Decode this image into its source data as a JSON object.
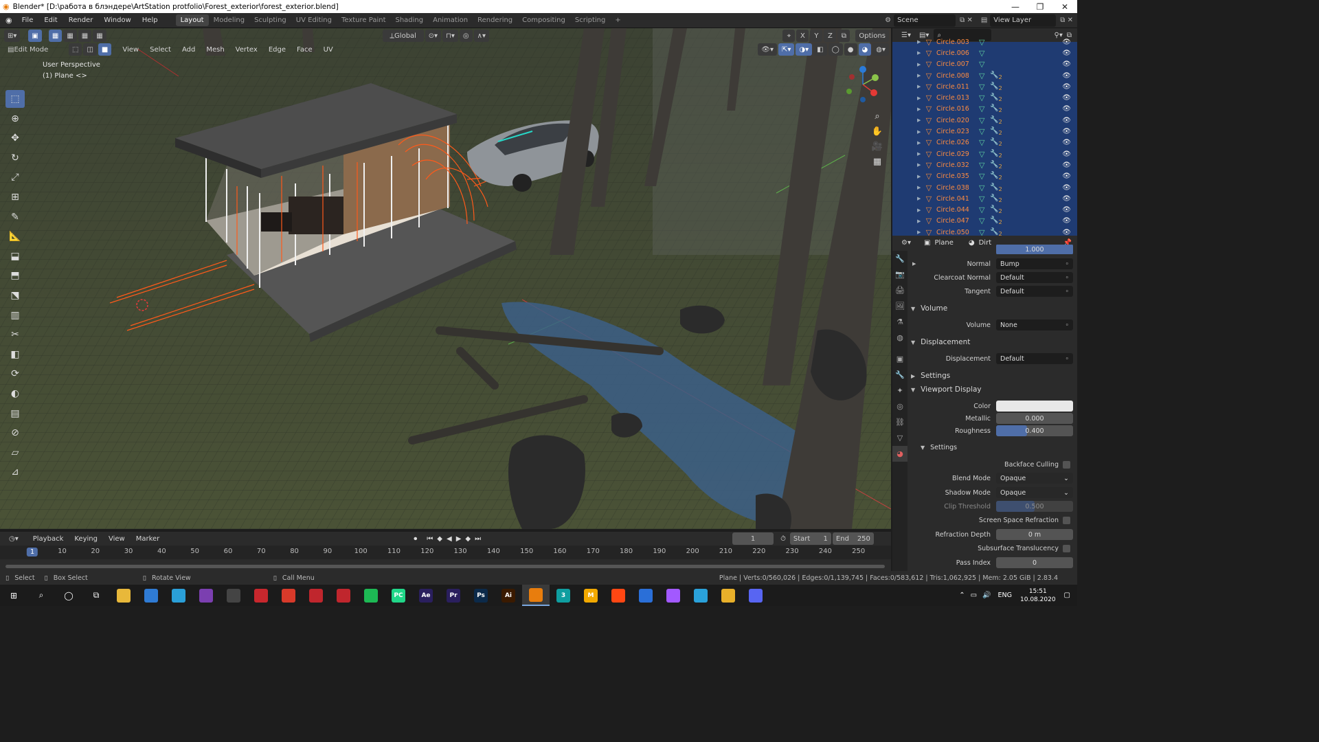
{
  "window": {
    "title": "Blender* [D:\\работа в блэндере\\ArtStation protfolio\\Forest_exterior\\forest_exterior.blend]",
    "minimize": "—",
    "maximize": "❐",
    "close": "✕"
  },
  "menu": [
    "File",
    "Edit",
    "Render",
    "Window",
    "Help"
  ],
  "workspaces": [
    "Layout",
    "Modeling",
    "Sculpting",
    "UV Editing",
    "Texture Paint",
    "Shading",
    "Animation",
    "Rendering",
    "Compositing",
    "Scripting"
  ],
  "workspace_add": "+",
  "scene_name": "Scene",
  "view_layer": "View Layer",
  "viewport_header": {
    "transform_orientation": "Global",
    "axis_x": "X",
    "axis_y": "Y",
    "axis_z": "Z",
    "options": "Options",
    "mode": "Edit Mode",
    "menus": [
      "View",
      "Select",
      "Add",
      "Mesh",
      "Vertex",
      "Edge",
      "Face",
      "UV"
    ]
  },
  "viewport_info": {
    "perspective": "User Perspective",
    "object": "(1) Plane <>"
  },
  "tools": [
    "select-box-icon",
    "cursor-icon",
    "move-icon",
    "rotate-icon",
    "scale-icon",
    "transform-icon",
    "annotate-icon",
    "measure-icon",
    "extrude-icon",
    "inset-icon",
    "bevel-icon",
    "loop-cut-icon",
    "knife-icon",
    "poly-build-icon",
    "spin-icon",
    "smooth-icon",
    "edge-slide-icon",
    "shrink-icon",
    "shear-icon",
    "rip-icon"
  ],
  "outliner": {
    "search_placeholder": "",
    "items": [
      "Circle.003",
      "Circle.006",
      "Circle.007",
      "Circle.008",
      "Circle.011",
      "Circle.013",
      "Circle.016",
      "Circle.020",
      "Circle.023",
      "Circle.026",
      "Circle.029",
      "Circle.032",
      "Circle.035",
      "Circle.038",
      "Circle.041",
      "Circle.044",
      "Circle.047",
      "Circle.050"
    ],
    "modifier_badge": "2"
  },
  "properties": {
    "object": "Plane",
    "material": "Dirt",
    "alpha_value": "1.000",
    "rows": {
      "normal": {
        "label": "Normal",
        "value": "Bump"
      },
      "clearcoat_normal": {
        "label": "Clearcoat Normal",
        "value": "Default"
      },
      "tangent": {
        "label": "Tangent",
        "value": "Default"
      },
      "volume_section": "Volume",
      "volume": {
        "label": "Volume",
        "value": "None"
      },
      "displacement_section": "Displacement",
      "displacement": {
        "label": "Displacement",
        "value": "Default"
      },
      "settings_section": "Settings",
      "viewport_display_section": "Viewport Display",
      "color": {
        "label": "Color"
      },
      "metallic": {
        "label": "Metallic",
        "value": "0.000",
        "fraction": 0.0
      },
      "roughness": {
        "label": "Roughness",
        "value": "0.400",
        "fraction": 0.4
      },
      "sub_settings_section": "Settings",
      "backface_culling": {
        "label": "Backface Culling"
      },
      "blend_mode": {
        "label": "Blend Mode",
        "value": "Opaque"
      },
      "shadow_mode": {
        "label": "Shadow Mode",
        "value": "Opaque"
      },
      "clip_threshold": {
        "label": "Clip Threshold",
        "value": "0.500",
        "fraction": 0.5
      },
      "ssr": {
        "label": "Screen Space Refraction"
      },
      "refraction_depth": {
        "label": "Refraction Depth",
        "value": "0 m"
      },
      "sss": {
        "label": "Subsurface Translucency"
      },
      "pass_index": {
        "label": "Pass Index",
        "value": "0"
      }
    }
  },
  "timeline": {
    "menus": [
      "Playback",
      "Keying",
      "View",
      "Marker"
    ],
    "current_frame": "1",
    "start_label": "Start",
    "start": "1",
    "end_label": "End",
    "end": "250",
    "ticks": [
      "1",
      "10",
      "20",
      "30",
      "40",
      "50",
      "60",
      "70",
      "80",
      "90",
      "100",
      "110",
      "120",
      "130",
      "140",
      "150",
      "160",
      "170",
      "180",
      "190",
      "200",
      "210",
      "220",
      "230",
      "240",
      "250"
    ]
  },
  "statusbar": {
    "select": "Select",
    "box_select": "Box Select",
    "rotate_view": "Rotate View",
    "call_menu": "Call Menu",
    "stats": "Plane | Verts:0/560,026 | Edges:0/1,139,745 | Faces:0/583,612 | Tris:1,062,925 | Mem: 2.05 GiB | 2.83.4"
  },
  "taskbar": {
    "apps": [
      {
        "name": "file-explorer",
        "label": "",
        "color": "#e8b83a"
      },
      {
        "name": "mail",
        "label": "",
        "color": "#2f7bd4"
      },
      {
        "name": "edge",
        "label": "",
        "color": "#2a9fd8"
      },
      {
        "name": "tor",
        "label": "",
        "color": "#7b3fb0"
      },
      {
        "name": "unity-hub",
        "label": "",
        "color": "#444"
      },
      {
        "name": "autocad",
        "label": "",
        "color": "#c8272d"
      },
      {
        "name": "sketchup",
        "label": "",
        "color": "#d83a2a"
      },
      {
        "name": "app-red-1",
        "label": "",
        "color": "#c0262d"
      },
      {
        "name": "app-red-2",
        "label": "",
        "color": "#c0262d"
      },
      {
        "name": "spotify",
        "label": "",
        "color": "#1db954"
      },
      {
        "name": "pycharm",
        "label": "PC",
        "color": "#21d789"
      },
      {
        "name": "after-effects",
        "label": "Ae",
        "color": "#2a1f5e"
      },
      {
        "name": "premiere",
        "label": "Pr",
        "color": "#2a1f5e"
      },
      {
        "name": "photoshop",
        "label": "Ps",
        "color": "#0c2a4a"
      },
      {
        "name": "illustrator",
        "label": "Ai",
        "color": "#3a1a00"
      },
      {
        "name": "blender",
        "label": "",
        "color": "#e87d0d"
      },
      {
        "name": "3ds-max",
        "label": "3",
        "color": "#0f9ea0"
      },
      {
        "name": "app-m",
        "label": "M",
        "color": "#f2a900"
      },
      {
        "name": "houdini",
        "label": "",
        "color": "#ff4713"
      },
      {
        "name": "app-s",
        "label": "",
        "color": "#2a6fd8"
      },
      {
        "name": "figma",
        "label": "",
        "color": "#a259ff"
      },
      {
        "name": "telegram",
        "label": "",
        "color": "#2aa1da"
      },
      {
        "name": "chrome",
        "label": "",
        "color": "#e8b02a"
      },
      {
        "name": "discord",
        "label": "",
        "color": "#5865f2"
      }
    ],
    "language": "ENG",
    "time": "15:51",
    "date": "10.08.2020"
  },
  "colors": {
    "accent": "#4f6ea8",
    "outliner_selected": "#1f3b72",
    "object_orange": "#ff8c40",
    "viewport_bg": "#3f4536",
    "panel": "#2b2b2b"
  }
}
